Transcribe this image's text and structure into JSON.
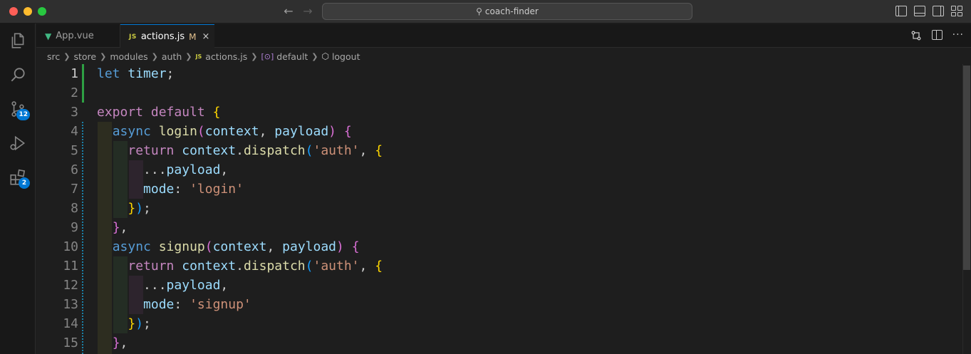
{
  "window": {
    "title": "coach-finder"
  },
  "tabs": [
    {
      "label": "App.vue",
      "icon": "vue-icon",
      "active": false
    },
    {
      "label": "actions.js",
      "icon": "js-icon",
      "active": true,
      "modified": "M"
    }
  ],
  "icons": {
    "vue_glyph": "▼",
    "js_glyph": "JS",
    "close": "×"
  },
  "activity_bar": {
    "source_control_badge": "12",
    "extensions_badge": "2"
  },
  "breadcrumb": [
    "src",
    "store",
    "modules",
    "auth",
    "actions.js",
    "default",
    "logout"
  ],
  "editor": {
    "line_numbers": [
      "1",
      "2",
      "3",
      "4",
      "5",
      "6",
      "7",
      "8",
      "9",
      "10",
      "11",
      "12",
      "13",
      "14",
      "15"
    ],
    "lines": [
      [
        [
          "kwb",
          "let"
        ],
        [
          "pun",
          " "
        ],
        [
          "var",
          "timer"
        ],
        [
          "pun",
          ";"
        ]
      ],
      [],
      [
        [
          "kw",
          "export"
        ],
        [
          "pun",
          " "
        ],
        [
          "kw",
          "default"
        ],
        [
          "pun",
          " "
        ],
        [
          "b1",
          "{"
        ]
      ],
      [
        [
          "pun",
          "  "
        ],
        [
          "kwb",
          "async"
        ],
        [
          "pun",
          " "
        ],
        [
          "fn",
          "login"
        ],
        [
          "b2",
          "("
        ],
        [
          "var",
          "context"
        ],
        [
          "pun",
          ", "
        ],
        [
          "var",
          "payload"
        ],
        [
          "b2",
          ")"
        ],
        [
          "pun",
          " "
        ],
        [
          "b2",
          "{"
        ]
      ],
      [
        [
          "pun",
          "    "
        ],
        [
          "kw",
          "return"
        ],
        [
          "pun",
          " "
        ],
        [
          "var",
          "context"
        ],
        [
          "pun",
          "."
        ],
        [
          "fn",
          "dispatch"
        ],
        [
          "b3",
          "("
        ],
        [
          "str",
          "'auth'"
        ],
        [
          "pun",
          ", "
        ],
        [
          "b1",
          "{"
        ]
      ],
      [
        [
          "pun",
          "      "
        ],
        [
          "pun",
          "..."
        ],
        [
          "var",
          "payload"
        ],
        [
          "pun",
          ","
        ]
      ],
      [
        [
          "pun",
          "      "
        ],
        [
          "var",
          "mode"
        ],
        [
          "pun",
          ": "
        ],
        [
          "str",
          "'login'"
        ]
      ],
      [
        [
          "pun",
          "    "
        ],
        [
          "b1",
          "}"
        ],
        [
          "b3",
          ")"
        ],
        [
          "pun",
          ";"
        ]
      ],
      [
        [
          "pun",
          "  "
        ],
        [
          "b2",
          "}"
        ],
        [
          "pun",
          ","
        ]
      ],
      [
        [
          "pun",
          "  "
        ],
        [
          "kwb",
          "async"
        ],
        [
          "pun",
          " "
        ],
        [
          "fn",
          "signup"
        ],
        [
          "b2",
          "("
        ],
        [
          "var",
          "context"
        ],
        [
          "pun",
          ", "
        ],
        [
          "var",
          "payload"
        ],
        [
          "b2",
          ")"
        ],
        [
          "pun",
          " "
        ],
        [
          "b2",
          "{"
        ]
      ],
      [
        [
          "pun",
          "    "
        ],
        [
          "kw",
          "return"
        ],
        [
          "pun",
          " "
        ],
        [
          "var",
          "context"
        ],
        [
          "pun",
          "."
        ],
        [
          "fn",
          "dispatch"
        ],
        [
          "b3",
          "("
        ],
        [
          "str",
          "'auth'"
        ],
        [
          "pun",
          ", "
        ],
        [
          "b1",
          "{"
        ]
      ],
      [
        [
          "pun",
          "      "
        ],
        [
          "pun",
          "..."
        ],
        [
          "var",
          "payload"
        ],
        [
          "pun",
          ","
        ]
      ],
      [
        [
          "pun",
          "      "
        ],
        [
          "var",
          "mode"
        ],
        [
          "pun",
          ": "
        ],
        [
          "str",
          "'signup'"
        ]
      ],
      [
        [
          "pun",
          "    "
        ],
        [
          "b1",
          "}"
        ],
        [
          "b3",
          ")"
        ],
        [
          "pun",
          ";"
        ]
      ],
      [
        [
          "pun",
          "  "
        ],
        [
          "b2",
          "}"
        ],
        [
          "pun",
          ","
        ]
      ]
    ]
  },
  "colors": {
    "keyword": "#c586c0",
    "storage": "#569cd6",
    "variable": "#9cdcfe",
    "function": "#dcdcaa",
    "string": "#ce9178",
    "accent": "#0078d4"
  }
}
